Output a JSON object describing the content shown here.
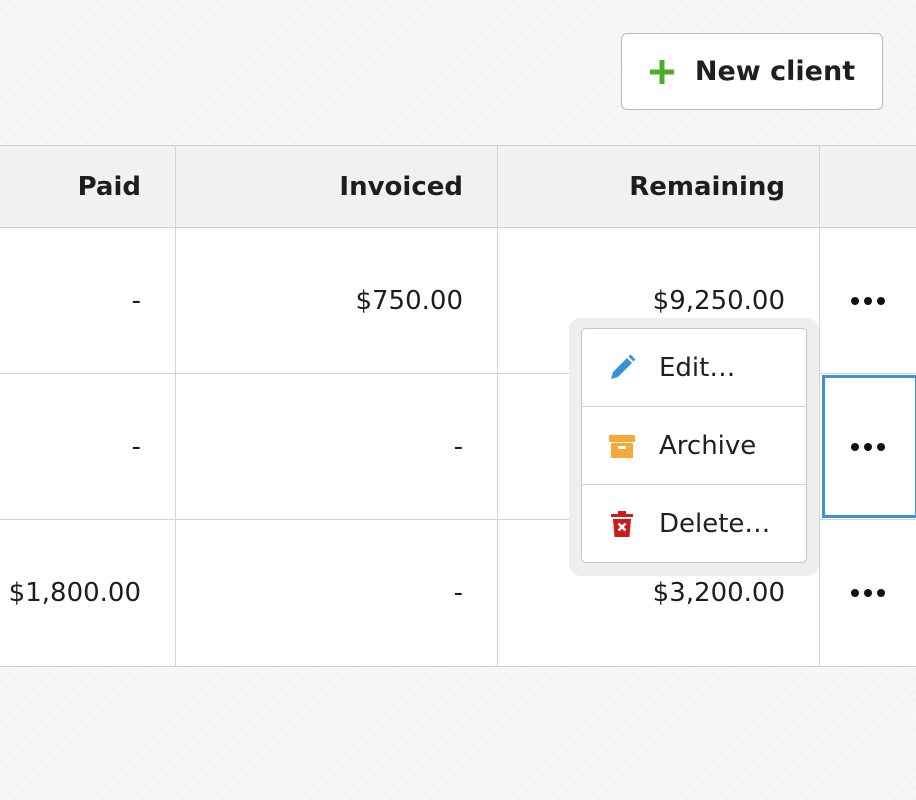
{
  "toolbar": {
    "new_client_label": "New client",
    "accent_color": "#4caf2a"
  },
  "table": {
    "columns": [
      "Paid",
      "Invoiced",
      "Remaining"
    ],
    "rows": [
      {
        "paid": "-",
        "invoiced": "$750.00",
        "remaining": "$9,250.00"
      },
      {
        "paid": "-",
        "invoiced": "-",
        "remaining": ""
      },
      {
        "paid": "$1,800.00",
        "invoiced": "-",
        "remaining": "$3,200.00"
      }
    ],
    "row_action_icon": "more-horizontal-icon"
  },
  "context_menu": {
    "items": [
      {
        "label": "Edit…",
        "icon": "pencil-icon",
        "color": "#3a8fd9"
      },
      {
        "label": "Archive",
        "icon": "archive-box-icon",
        "color": "#f6a83a"
      },
      {
        "label": "Delete…",
        "icon": "trash-icon",
        "color": "#cc1b1b"
      }
    ]
  }
}
